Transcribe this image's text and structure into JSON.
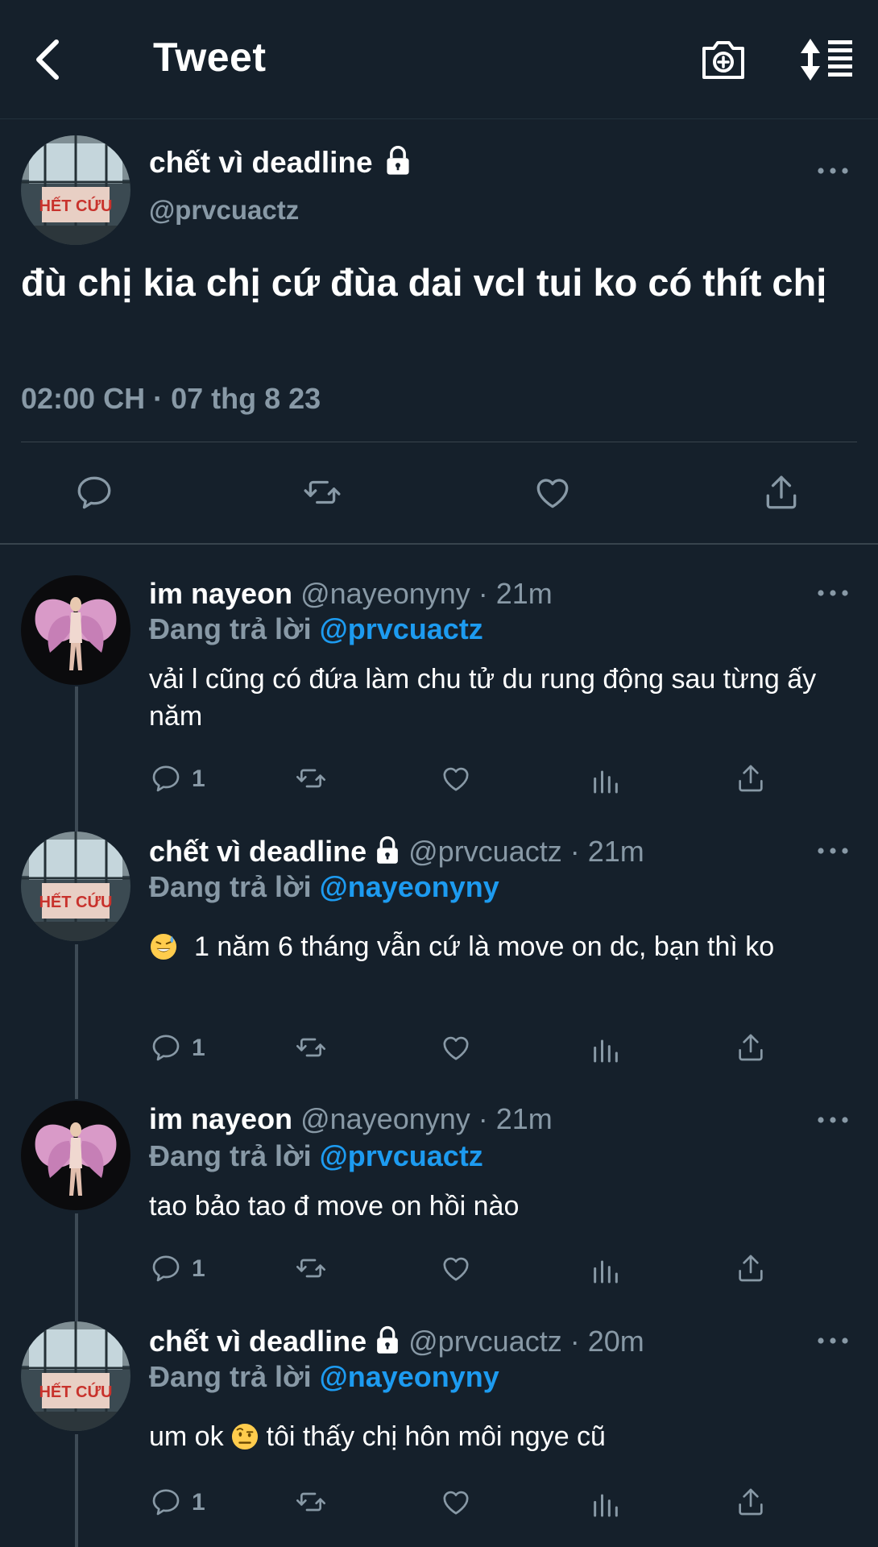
{
  "header": {
    "title": "Tweet"
  },
  "main_tweet": {
    "name": "chết vì deadline",
    "handle": "@prvcuactz",
    "text": "đù chị kia chị cứ đùa dai vcl tui ko có thít chị",
    "timestamp": "02:00 CH · 07 thg 8 23",
    "avatar_sign_text": "HẾT CỨU"
  },
  "replies": [
    {
      "name": "im nayeon",
      "meta": "@nayeonyny · 21m",
      "replying_label": "Đang trả lời",
      "replying_to": "@prvcuactz",
      "text": "vải l cũng có đứa làm chu tử du rung động sau từng ấy năm",
      "reply_count": "1"
    },
    {
      "name": "chết vì deadline",
      "meta": "@prvcuactz · 21m",
      "replying_label": "Đang trả lời",
      "replying_to": "@nayeonyny",
      "text": "1 năm 6 tháng vẫn cứ là move on dc, bạn thì ko",
      "reply_count": "1"
    },
    {
      "name": "im nayeon",
      "meta": "@nayeonyny · 21m",
      "replying_label": "Đang trả lời",
      "replying_to": "@prvcuactz",
      "text": "tao bảo tao đ move on hồi nào",
      "reply_count": "1"
    },
    {
      "name": "chết vì deadline",
      "meta": "@prvcuactz · 20m",
      "replying_label": "Đang trả lời",
      "replying_to": "@nayeonyny",
      "text_before": "um ok",
      "text_after": "tôi thấy chị hôn môi ngye cũ",
      "reply_count": "1"
    }
  ],
  "colors": {
    "background": "#15202b",
    "secondary_text": "#8899a6",
    "mention": "#1d9bf0",
    "divider": "#38444d"
  }
}
